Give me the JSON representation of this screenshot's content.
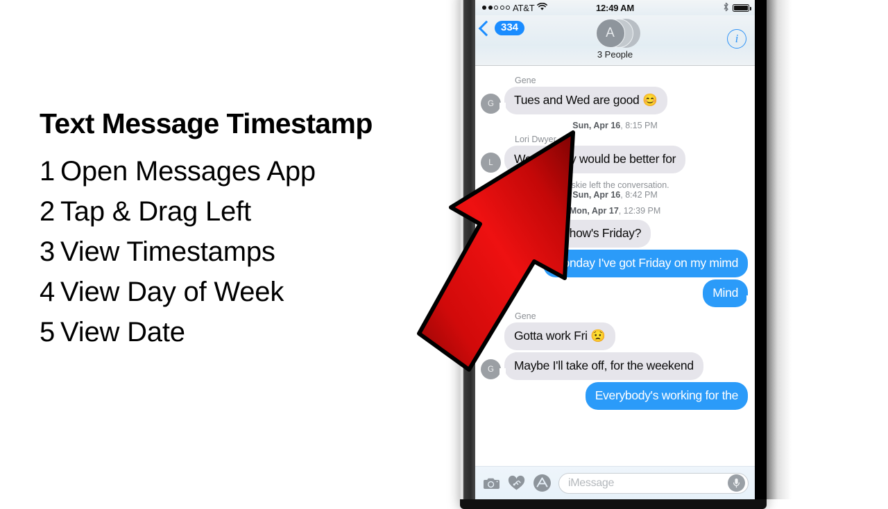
{
  "lesson": {
    "title": "Text Message Timestamp",
    "steps": [
      {
        "num": "1",
        "text": "Open Messages App"
      },
      {
        "num": "2",
        "text": "Tap & Drag Left"
      },
      {
        "num": "3",
        "text": "View Timestamps"
      },
      {
        "num": "4",
        "text": "View Day of Week"
      },
      {
        "num": "5",
        "text": "View Date"
      }
    ]
  },
  "phone": {
    "status_bar": {
      "carrier": "AT&T",
      "signal_filled": 2,
      "signal_total": 5,
      "wifi_icon": "wifi-icon",
      "time": "12:49 AM",
      "bluetooth_icon": "bluetooth-icon",
      "battery_icon": "battery-full-icon"
    },
    "nav_bar": {
      "back_badge": "334",
      "back_chevron_icon": "chevron-left-icon",
      "avatar_initial": "A",
      "group_name": "3 People",
      "info_icon": "info-circle-icon"
    },
    "thread": [
      {
        "type": "sender",
        "name": "Gene"
      },
      {
        "type": "incoming",
        "avatar": "G",
        "text": "Tues and Wed are good 😊",
        "tail": true
      },
      {
        "type": "divider",
        "day": "Sun, Apr 16",
        "time": "8:15 PM"
      },
      {
        "type": "sender",
        "name": "Lori Dwyer"
      },
      {
        "type": "incoming",
        "avatar": "L",
        "text": "Wednesday would be better for",
        "tail": false
      },
      {
        "type": "system",
        "day": "Sun, Apr 16",
        "time": "8:42 PM",
        "text": "Briskie left the conversation."
      },
      {
        "type": "divider",
        "day": "Mon, Apr 17",
        "time": "12:39 PM"
      },
      {
        "type": "incoming",
        "avatar": "",
        "text": "Hey guys, how's Friday?",
        "tail": false
      },
      {
        "type": "outgoing",
        "text": "Monday I've got Friday on my mimd",
        "tail": false
      },
      {
        "type": "outgoing",
        "text": "Mind",
        "tail": true
      },
      {
        "type": "sender",
        "name": "Gene"
      },
      {
        "type": "incoming",
        "avatar": "",
        "text": "Gotta work Fri 😟",
        "tail": false
      },
      {
        "type": "incoming",
        "avatar": "G",
        "text": "Maybe I'll take off, for the weekend",
        "tail": true
      },
      {
        "type": "outgoing",
        "text": "Everybody's working for the",
        "tail": false
      }
    ],
    "toolbar": {
      "camera_icon": "camera-icon",
      "digital_touch_icon": "heart-digital-touch-icon",
      "app_store_icon": "app-store-icon",
      "input_placeholder": "iMessage",
      "mic_icon": "microphone-icon"
    }
  },
  "annotation": {
    "arrow_icon": "red-arrow-up-right-icon",
    "arrow_color": "#d80b0b"
  },
  "colors": {
    "imessage_blue": "#2b9bf9",
    "incoming_gray": "#e6e5eb",
    "tint_blue": "#1a8cff"
  }
}
